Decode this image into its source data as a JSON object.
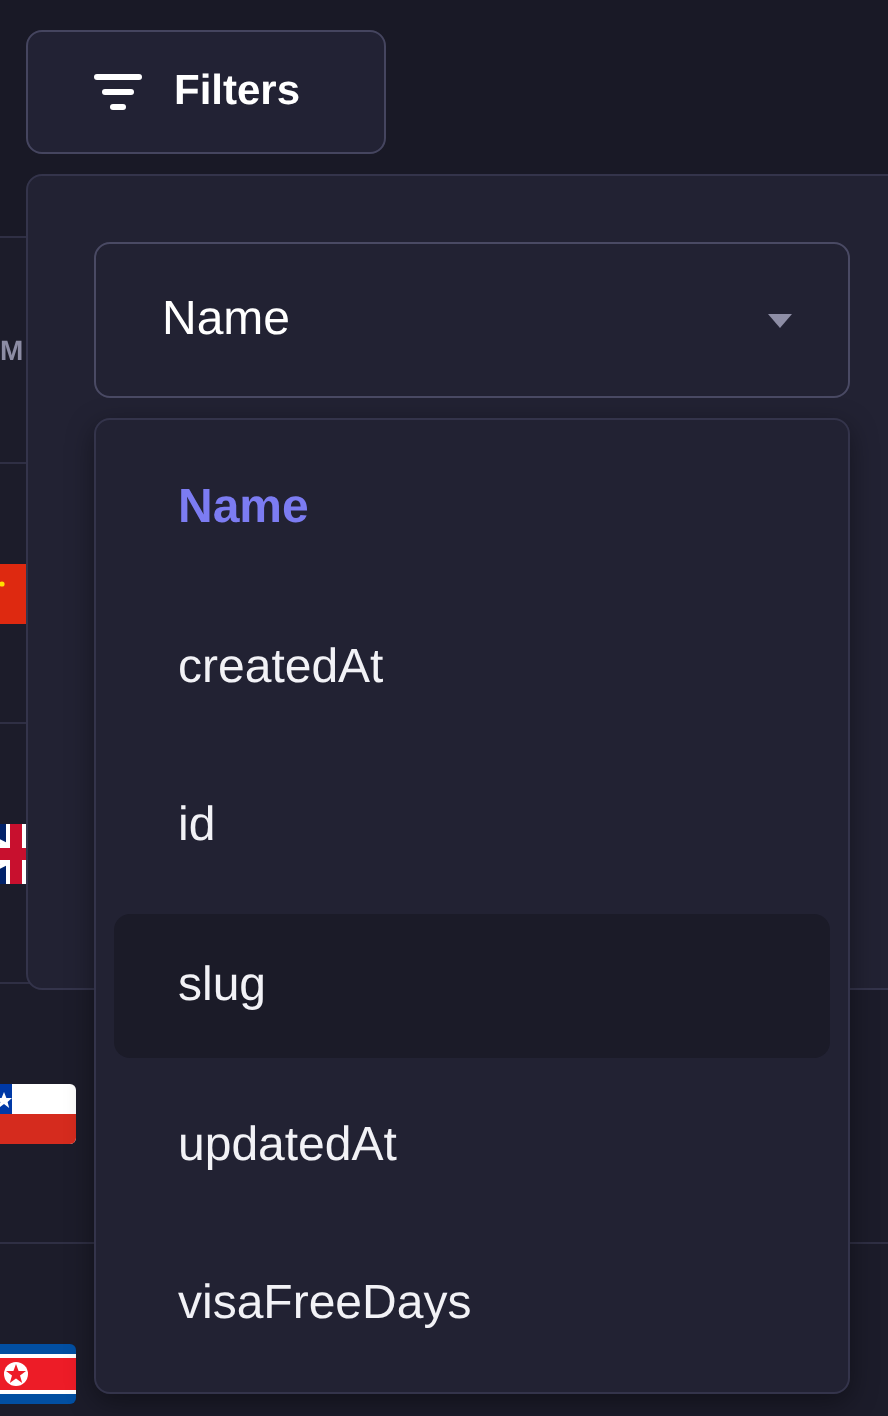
{
  "filter_button": {
    "label": "Filters"
  },
  "table": {
    "columns": [
      {
        "label": "M"
      }
    ],
    "rows": [
      {
        "kind": "cn"
      },
      {
        "kind": "gb"
      },
      {
        "kind": "cl"
      },
      {
        "kind": "kp"
      }
    ]
  },
  "field_select": {
    "value": "Name",
    "expanded": true
  },
  "options": [
    {
      "label": "Name",
      "selected": true,
      "hovered": false
    },
    {
      "label": "createdAt",
      "selected": false,
      "hovered": false
    },
    {
      "label": "id",
      "selected": false,
      "hovered": false
    },
    {
      "label": "slug",
      "selected": false,
      "hovered": true
    },
    {
      "label": "updatedAt",
      "selected": false,
      "hovered": false
    },
    {
      "label": "visaFreeDays",
      "selected": false,
      "hovered": false
    }
  ]
}
